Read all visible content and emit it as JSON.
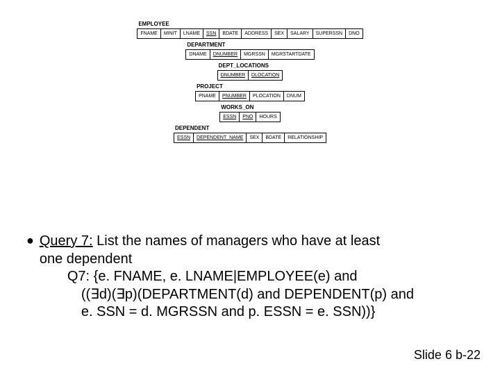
{
  "schemas": {
    "employee": {
      "label": "EMPLOYEE",
      "cols": [
        "FNAME",
        "MINIT",
        "LNAME",
        "SSN",
        "BDATE",
        "ADDRESS",
        "SEX",
        "SALARY",
        "SUPERSSN",
        "DNO"
      ],
      "underline": [
        3
      ]
    },
    "department": {
      "label": "DEPARTMENT",
      "cols": [
        "DNAME",
        "DNUMBER",
        "MGRSSN",
        "MGRSTARTDATE"
      ],
      "underline": [
        1
      ]
    },
    "dept_locations": {
      "label": "DEPT_LOCATIONS",
      "cols": [
        "DNUMBER",
        "DLOCATION"
      ],
      "underline": [
        0,
        1
      ]
    },
    "project": {
      "label": "PROJECT",
      "cols": [
        "PNAME",
        "PNUMBER",
        "PLOCATION",
        "DNUM"
      ],
      "underline": [
        1
      ]
    },
    "works_on": {
      "label": "WORKS_ON",
      "cols": [
        "ESSN",
        "PNO",
        "HOURS"
      ],
      "underline": [
        0,
        1
      ]
    },
    "dependent": {
      "label": "DEPENDENT",
      "cols": [
        "ESSN",
        "DEPENDENT_NAME",
        "SEX",
        "BDATE",
        "RELATIONSHIP"
      ],
      "underline": [
        0,
        1
      ]
    }
  },
  "query": {
    "label": "Query 7:",
    "desc1": " List the names of managers who have at least",
    "desc2": "one dependent",
    "line1": "Q7: {e. FNAME, e. LNAME|EMPLOYEE(e) and",
    "line2": "((∃d)(∃p)(DEPARTMENT(d) and DEPENDENT(p) and",
    "line3": "e. SSN = d. MGRSSN and p. ESSN = e. SSN))}"
  },
  "slide": "Slide 6 b-22",
  "bullet": "●"
}
